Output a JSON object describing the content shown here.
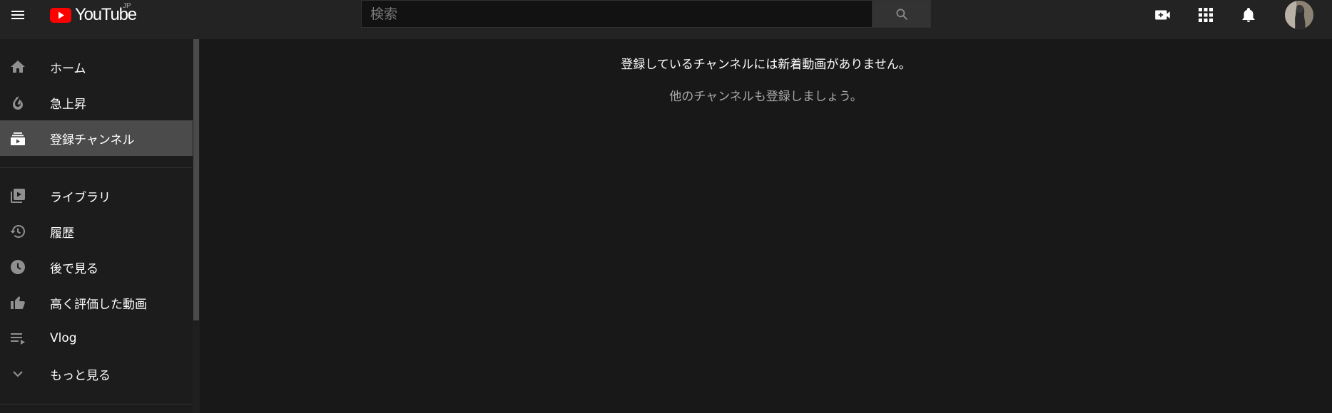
{
  "header": {
    "logo_text": "YouTube",
    "region": "JP",
    "search": {
      "placeholder": "検索",
      "value": ""
    }
  },
  "icons": {
    "menu": "hamburger-icon",
    "search": "search-icon",
    "create": "video-camera-add-icon",
    "apps": "apps-grid-icon",
    "notifications": "bell-icon",
    "avatar": "user-avatar"
  },
  "sidebar": {
    "items": [
      {
        "label": "ホーム",
        "icon": "home-icon"
      },
      {
        "label": "急上昇",
        "icon": "flame-icon"
      },
      {
        "label": "登録チャンネル",
        "icon": "subscriptions-icon",
        "active": true
      },
      {
        "label": "ライブラリ",
        "icon": "library-icon"
      },
      {
        "label": "履歴",
        "icon": "history-icon"
      },
      {
        "label": "後で見る",
        "icon": "clock-icon"
      },
      {
        "label": "高く評価した動画",
        "icon": "thumbs-up-icon"
      },
      {
        "label": "Vlog",
        "icon": "playlist-icon"
      },
      {
        "label": "もっと見る",
        "icon": "chevron-down-icon"
      }
    ]
  },
  "main": {
    "empty_title": "登録しているチャンネルには新着動画がありません。",
    "empty_hint": "他のチャンネルも登録しましょう。"
  },
  "colors": {
    "background": "#181818",
    "topbar": "#232323",
    "sidebar": "#1c1c1c",
    "active_item": "#4b4b4b",
    "brand_red": "#ff0000",
    "secondary_text": "#aaaaaa"
  }
}
